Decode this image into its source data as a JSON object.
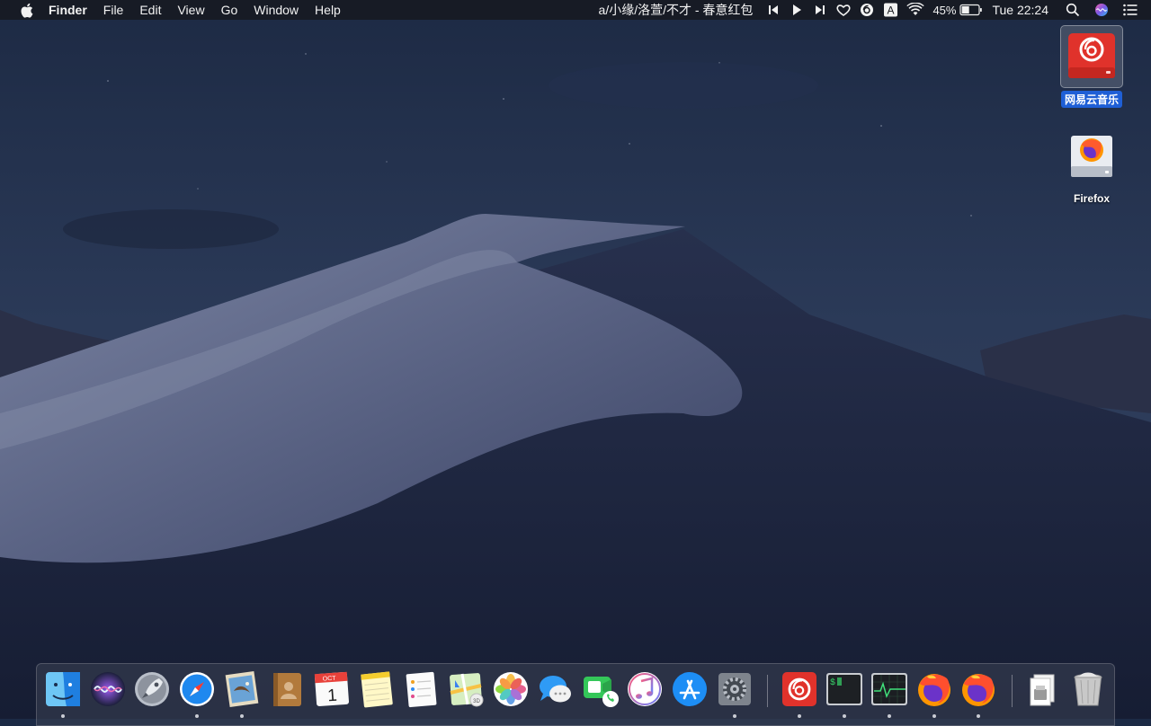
{
  "menubar": {
    "app_name": "Finder",
    "menus": [
      "File",
      "Edit",
      "View",
      "Go",
      "Window",
      "Help"
    ],
    "now_playing": "a/小缘/洛萱/不才 - 春意红包",
    "input_source": "A",
    "battery_percent": "45%",
    "clock": "Tue 22:24"
  },
  "desktop": {
    "icons": [
      {
        "label": "网易云音乐",
        "selected": true,
        "icon": "netease-music-disk-icon"
      },
      {
        "label": "Firefox",
        "selected": false,
        "icon": "firefox-disk-icon"
      }
    ]
  },
  "dock": {
    "apps": [
      {
        "name": "Finder",
        "icon": "finder-icon",
        "running": true
      },
      {
        "name": "Siri",
        "icon": "siri-icon",
        "running": false
      },
      {
        "name": "Launchpad",
        "icon": "launchpad-icon",
        "running": false
      },
      {
        "name": "Safari",
        "icon": "safari-icon",
        "running": true
      },
      {
        "name": "Mail",
        "icon": "mail-icon",
        "running": true
      },
      {
        "name": "Contacts",
        "icon": "contacts-icon",
        "running": false
      },
      {
        "name": "Calendar",
        "icon": "calendar-icon",
        "running": false,
        "month": "OCT",
        "day": "1"
      },
      {
        "name": "Notes",
        "icon": "notes-icon",
        "running": false
      },
      {
        "name": "Reminders",
        "icon": "reminders-icon",
        "running": false
      },
      {
        "name": "Maps",
        "icon": "maps-icon",
        "running": false
      },
      {
        "name": "Photos",
        "icon": "photos-icon",
        "running": false
      },
      {
        "name": "Messages",
        "icon": "messages-icon",
        "running": false
      },
      {
        "name": "FaceTime",
        "icon": "facetime-icon",
        "running": false
      },
      {
        "name": "iTunes",
        "icon": "itunes-icon",
        "running": false
      },
      {
        "name": "App Store",
        "icon": "app-store-icon",
        "running": false
      },
      {
        "name": "System Preferences",
        "icon": "system-preferences-icon",
        "running": true
      },
      {
        "name": "NetEase Cloud Music",
        "icon": "netease-music-icon",
        "running": true
      },
      {
        "name": "Terminal",
        "icon": "terminal-icon",
        "running": true
      },
      {
        "name": "Activity Monitor",
        "icon": "activity-monitor-icon",
        "running": true
      },
      {
        "name": "Firefox",
        "icon": "firefox-icon",
        "running": true
      },
      {
        "name": "Firefox",
        "icon": "firefox-icon",
        "running": true
      },
      {
        "name": "Downloads",
        "icon": "downloads-stack-icon",
        "running": false
      },
      {
        "name": "Trash",
        "icon": "trash-icon",
        "running": false
      }
    ]
  },
  "colors": {
    "menubar_bg": "#16181e",
    "selection_blue": "#1f5fd6",
    "netease_red": "#e0322b"
  }
}
